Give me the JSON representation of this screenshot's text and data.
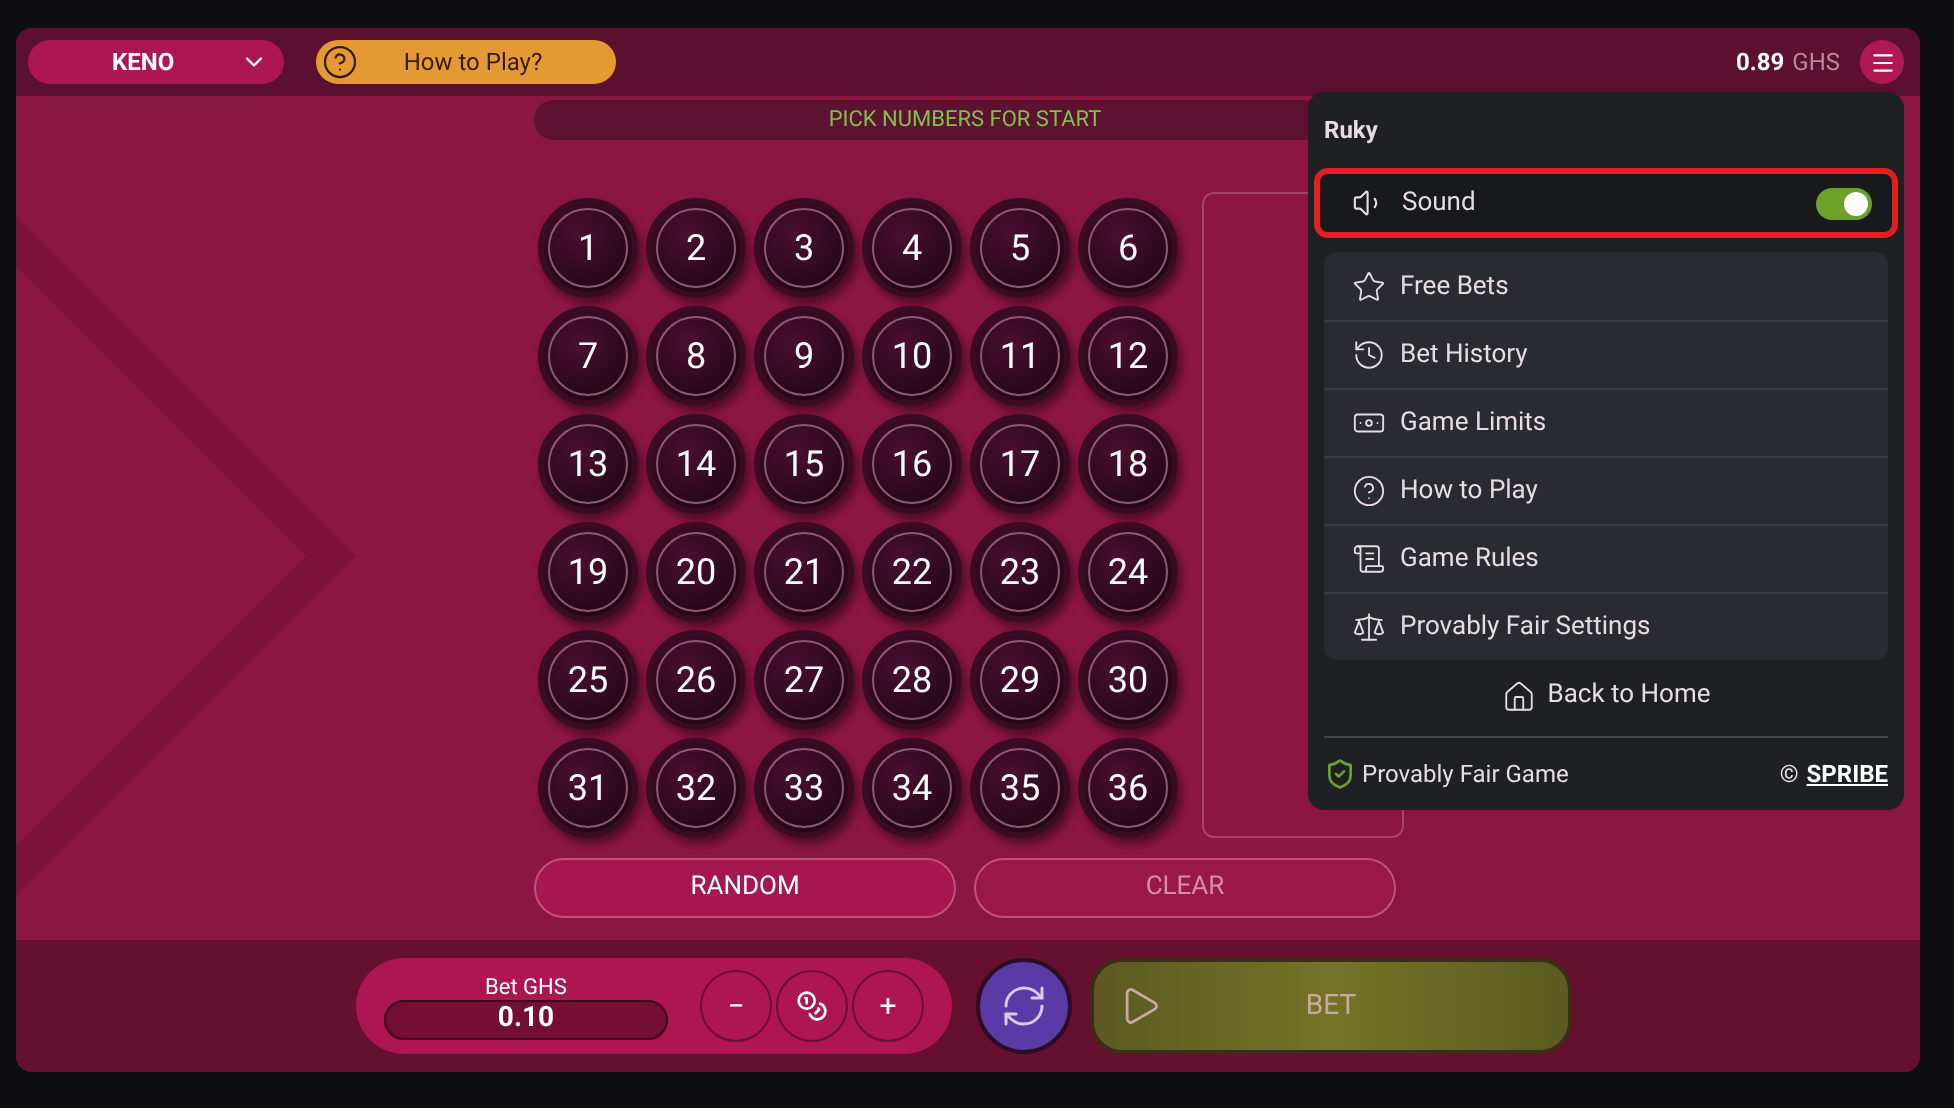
{
  "header": {
    "game_select": "KENO",
    "how_to_play": "How to Play?",
    "balance_amount": "0.89",
    "balance_currency": "GHS"
  },
  "status_bar": {
    "text": "PICK NUMBERS FOR START"
  },
  "numbers": [
    {
      "label": "1",
      "selected": false
    },
    {
      "label": "2",
      "selected": false
    },
    {
      "label": "3",
      "selected": false
    },
    {
      "label": "4",
      "selected": false
    },
    {
      "label": "5",
      "selected": false
    },
    {
      "label": "6",
      "selected": false
    },
    {
      "label": "7",
      "selected": false
    },
    {
      "label": "8",
      "selected": false
    },
    {
      "label": "9",
      "selected": false
    },
    {
      "label": "10",
      "selected": false
    },
    {
      "label": "11",
      "selected": false
    },
    {
      "label": "12",
      "selected": false
    },
    {
      "label": "13",
      "selected": false
    },
    {
      "label": "14",
      "selected": false
    },
    {
      "label": "15",
      "selected": false
    },
    {
      "label": "16",
      "selected": false
    },
    {
      "label": "17",
      "selected": false
    },
    {
      "label": "18",
      "selected": false
    },
    {
      "label": "19",
      "selected": false
    },
    {
      "label": "20",
      "selected": false
    },
    {
      "label": "21",
      "selected": false
    },
    {
      "label": "22",
      "selected": false
    },
    {
      "label": "23",
      "selected": false
    },
    {
      "label": "24",
      "selected": false
    },
    {
      "label": "25",
      "selected": false
    },
    {
      "label": "26",
      "selected": false
    },
    {
      "label": "27",
      "selected": false
    },
    {
      "label": "28",
      "selected": false
    },
    {
      "label": "29",
      "selected": false
    },
    {
      "label": "30",
      "selected": false
    },
    {
      "label": "31",
      "selected": false
    },
    {
      "label": "32",
      "selected": false
    },
    {
      "label": "33",
      "selected": false
    },
    {
      "label": "34",
      "selected": false
    },
    {
      "label": "35",
      "selected": false
    },
    {
      "label": "36",
      "selected": false
    }
  ],
  "actions": [
    {
      "label": "RANDOM",
      "disabled": false
    },
    {
      "label": "CLEAR",
      "disabled": true
    }
  ],
  "bet": {
    "label": "Bet GHS",
    "value": "0.10",
    "minus": "−",
    "plus": "+",
    "button": "BET"
  },
  "menu": {
    "user": "Ruky",
    "sound": {
      "label": "Sound",
      "on": true,
      "highlighted": true
    },
    "items": [
      {
        "label": "Free Bets",
        "kind": "star"
      },
      {
        "label": "Bet History",
        "kind": "history"
      },
      {
        "label": "Game Limits",
        "kind": "money"
      },
      {
        "label": "How to Play",
        "kind": "help"
      },
      {
        "label": "Game Rules",
        "kind": "rules"
      },
      {
        "label": "Provably Fair Settings",
        "kind": "scales"
      }
    ],
    "home": "Back to Home",
    "fair": "Provably Fair Game",
    "copyright": "©",
    "brand": "SPRIBE"
  }
}
